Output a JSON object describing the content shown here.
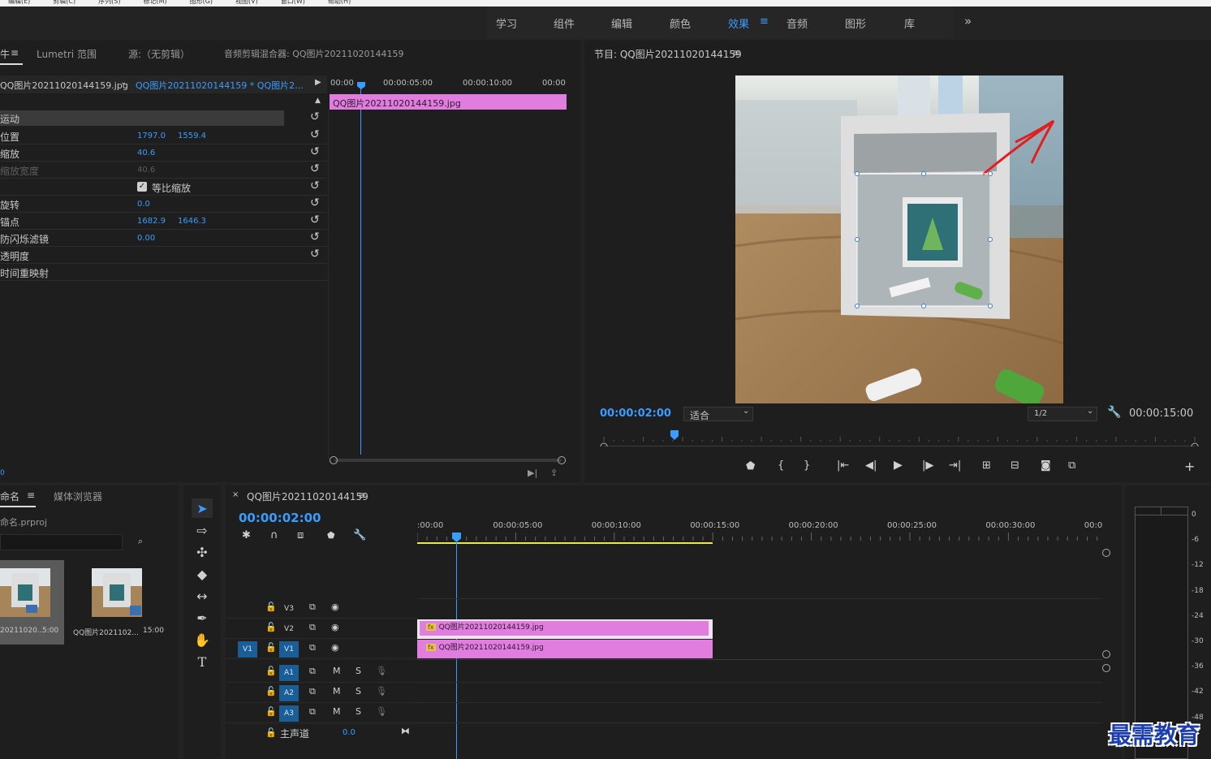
{
  "menubar": [
    "编辑(E)",
    "剪辑(C)",
    "序列(S)",
    "标记(M)",
    "图形(G)",
    "视图(V)",
    "窗口(W)",
    "帮助(H)"
  ],
  "workspaces": [
    {
      "label": "学习",
      "active": false
    },
    {
      "label": "组件",
      "active": false
    },
    {
      "label": "编辑",
      "active": false
    },
    {
      "label": "颜色",
      "active": false
    },
    {
      "label": "效果",
      "active": true
    },
    {
      "label": "音频",
      "active": false
    },
    {
      "label": "图形",
      "active": false
    },
    {
      "label": "库",
      "active": false
    }
  ],
  "ws_more": "»",
  "source_tabs": {
    "effect_controls_tail": "牛",
    "lumetri": "Lumetri 范围",
    "source": "源:（无剪辑）",
    "audio_mixer": "音频剪辑混合器: QQ图片20211020144159"
  },
  "effect_controls": {
    "master_clip": "QQ图片20211020144159.jpg",
    "sequence_clip": "QQ图片20211020144159 * QQ图片2...",
    "ruler": [
      "00:00",
      "00:00:05:00",
      "00:00:10:00",
      "00:00"
    ],
    "clip_label": "QQ图片20211020144159.jpg",
    "section": "运动",
    "rows": [
      {
        "label": "位置",
        "v1": "1797.0",
        "v2": "1559.4",
        "disabled": false
      },
      {
        "label": "缩放",
        "v1": "40.6",
        "v2": "",
        "disabled": false
      },
      {
        "label": "缩放宽度",
        "v1": "40.6",
        "v2": "",
        "disabled": true
      },
      {
        "label": "",
        "checkbox": "等比缩放",
        "disabled": false
      },
      {
        "label": "旋转",
        "v1": "0.0",
        "v2": "",
        "disabled": false
      },
      {
        "label": "锚点",
        "v1": "1682.9",
        "v2": "1646.3",
        "disabled": false
      },
      {
        "label": "防闪烁滤镜",
        "v1": "0.00",
        "v2": "",
        "disabled": false
      },
      {
        "label": "透明度",
        "v1": "",
        "v2": "",
        "disabled": false
      },
      {
        "label": "时间重映射",
        "v1": "",
        "v2": "",
        "disabled": false
      }
    ],
    "bottom_time": "0"
  },
  "program": {
    "title": "节目: QQ图片20211020144159",
    "timecode": "00:00:02:00",
    "zoom": "适合",
    "resolution": "1/2",
    "duration": "00:00:15:00",
    "playhead_fraction": 0.13
  },
  "project": {
    "tab_name": "命名",
    "tab_media": "媒体浏览器",
    "file": "命名.prproj",
    "items": [
      {
        "name": "20211020...",
        "dur": "5:00"
      },
      {
        "name": "QQ图片2021102...",
        "dur": "15:00"
      }
    ]
  },
  "timeline": {
    "title": "QQ图片20211020144159",
    "timecode": "00:00:02:00",
    "ruler": [
      ":00:00",
      "00:00:05:00",
      "00:00:10:00",
      "00:00:15:00",
      "00:00:20:00",
      "00:00:25:00",
      "00:00:30:00",
      "00:0"
    ],
    "video_tracks": [
      "V3",
      "V2",
      "V1"
    ],
    "source_patch": "V1",
    "audio_tracks": [
      "A1",
      "A2",
      "A3"
    ],
    "master_label": "主声道",
    "master_value": "0.0",
    "clips": [
      {
        "track": "V2",
        "label": "QQ图片20211020144159.jpg",
        "fx": "fx"
      },
      {
        "track": "V1",
        "label": "QQ图片20211020144159.jpg",
        "fx": "fx"
      }
    ],
    "audio_buttons": {
      "m": "M",
      "s": "S"
    }
  },
  "meter_labels": [
    "0",
    "-6",
    "-12",
    "-18",
    "-24",
    "-30",
    "-36",
    "-42",
    "-48"
  ],
  "watermark": "最需教育",
  "colors": {
    "accent": "#3a9cff",
    "clip": "#e27de0",
    "work_area": "#e8e84a"
  }
}
